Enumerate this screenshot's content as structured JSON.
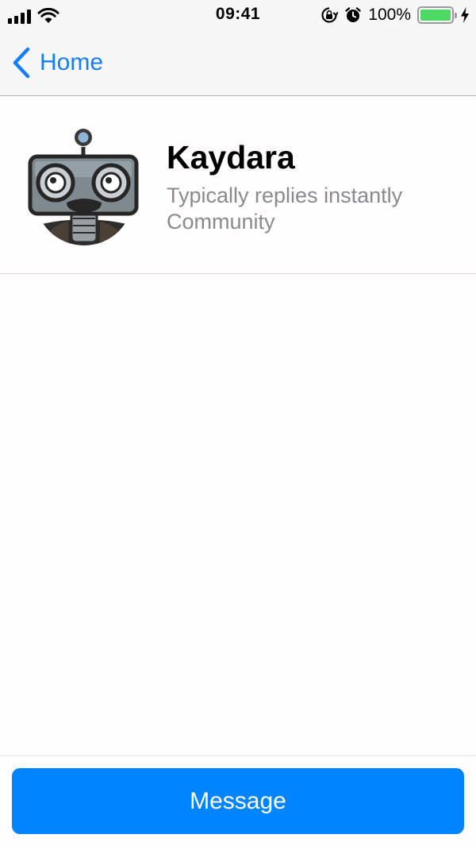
{
  "status_bar": {
    "time": "09:41",
    "battery_percent": "100%",
    "battery_level": 1.0,
    "icons": [
      "signal-icon",
      "wifi-icon",
      "orientation-lock-icon",
      "alarm-icon",
      "battery-icon",
      "charging-bolt-icon"
    ]
  },
  "nav": {
    "back_label": "Home"
  },
  "profile": {
    "name": "Kaydara",
    "reply_time": "Typically replies instantly",
    "team": "Community",
    "avatar_icon": "robot-avatar"
  },
  "actions": {
    "message_label": "Message"
  },
  "colors": {
    "accent": "#147efb",
    "button": "#0084ff",
    "battery": "#4cd964"
  }
}
